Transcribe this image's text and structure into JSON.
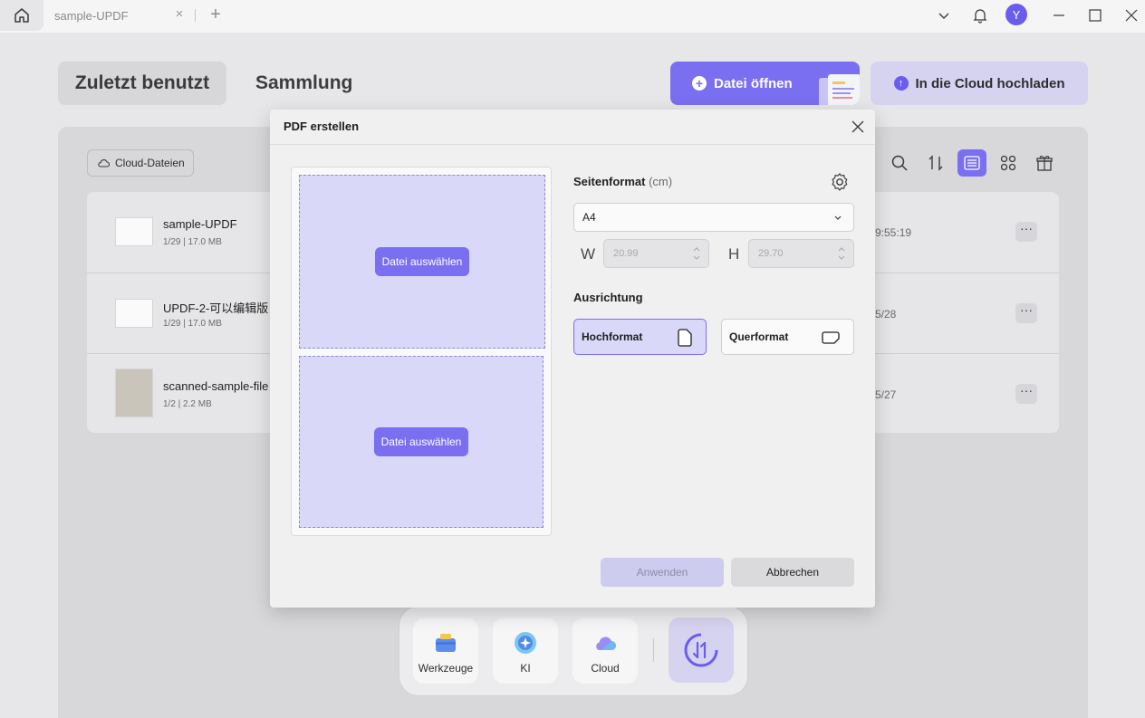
{
  "titlebar": {
    "tab_title": "sample-UPDF",
    "tab_close": "×",
    "add_tab": "+",
    "avatar_initial": "Y"
  },
  "header": {
    "recent_tab": "Zuletzt benutzt",
    "collection_tab": "Sammlung",
    "open_file": "Datei öffnen",
    "upload_cloud": "In die Cloud hochladen"
  },
  "toolbar": {
    "cloud_files": "Cloud-Dateien"
  },
  "files": [
    {
      "name": "sample-UPDF",
      "meta": "1/29 | 17.0 MB",
      "date": "9:55:19",
      "more": "···"
    },
    {
      "name": "UPDF-2-可以编辑版",
      "meta": "1/29 | 17.0 MB",
      "date": "5/28",
      "more": "···"
    },
    {
      "name": "scanned-sample-file",
      "meta": "1/2 | 2.2 MB",
      "date": "5/27",
      "more": "···"
    }
  ],
  "dock": {
    "tools": "Werkzeuge",
    "ai": "KI",
    "cloud": "Cloud"
  },
  "modal": {
    "title": "PDF erstellen",
    "slot1_button": "Datei auswählen",
    "slot2_button": "Datei auswählen",
    "page_format_label": "Seitenformat",
    "page_format_unit": "(cm)",
    "page_size": "A4",
    "width_label": "W",
    "width_value": "20.99",
    "height_label": "H",
    "height_value": "29.70",
    "orientation_label": "Ausrichtung",
    "portrait": "Hochformat",
    "landscape": "Querformat",
    "apply": "Anwenden",
    "cancel": "Abbrechen"
  },
  "colors": {
    "accent": "#7b6ff1",
    "accent_light": "#d9d8f8"
  }
}
